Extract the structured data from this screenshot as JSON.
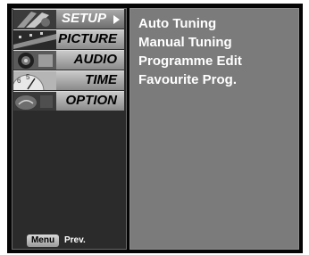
{
  "menu": {
    "items": [
      {
        "label": "SETUP",
        "icon": "setup-thumbnail-icon",
        "selected": true
      },
      {
        "label": "PICTURE",
        "icon": "picture-thumbnail-icon",
        "selected": false
      },
      {
        "label": "AUDIO",
        "icon": "audio-thumbnail-icon",
        "selected": false
      },
      {
        "label": "TIME",
        "icon": "time-thumbnail-icon",
        "selected": false
      },
      {
        "label": "OPTION",
        "icon": "option-thumbnail-icon",
        "selected": false
      }
    ]
  },
  "submenu": {
    "items": [
      "Auto Tuning",
      "Manual Tuning",
      "Programme Edit",
      "Favourite Prog."
    ]
  },
  "footer": {
    "menu_key": "Menu",
    "prev_label": "Prev."
  },
  "colors": {
    "menu_background": "#2b2b2b",
    "submenu_background": "#7b7b7b",
    "text": "#ffffff"
  }
}
